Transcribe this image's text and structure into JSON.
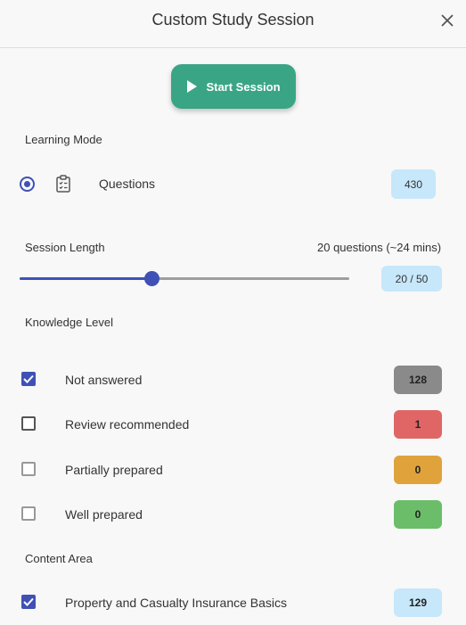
{
  "header": {
    "title": "Custom Study Session",
    "close_icon": "close-icon"
  },
  "start_button": {
    "label": "Start Session",
    "icon": "play-icon",
    "color": "#3aa585"
  },
  "learning_mode": {
    "label": "Learning Mode",
    "option": {
      "label": "Questions",
      "count": "430",
      "selected": true,
      "icon": "clipboard-list-icon"
    }
  },
  "session_length": {
    "label": "Session Length",
    "summary": "20 questions (~24 mins)",
    "value_badge": "20 / 50",
    "value": 20,
    "max": 50
  },
  "knowledge_level": {
    "label": "Knowledge Level",
    "items": [
      {
        "label": "Not answered",
        "count": "128",
        "checked": true,
        "color": "#8a8a8a"
      },
      {
        "label": "Review recommended",
        "count": "1",
        "checked": false,
        "color": "#e06666"
      },
      {
        "label": "Partially prepared",
        "count": "0",
        "checked": false,
        "color": "#e0a33b"
      },
      {
        "label": "Well prepared",
        "count": "0",
        "checked": false,
        "color": "#6cbd6a"
      }
    ]
  },
  "content_area": {
    "label": "Content Area",
    "items": [
      {
        "label": "Property and Casualty Insurance Basics",
        "count": "129",
        "checked": true
      }
    ]
  },
  "colors": {
    "accent": "#3f51b5",
    "badge_blue": "#c7e7fb"
  }
}
